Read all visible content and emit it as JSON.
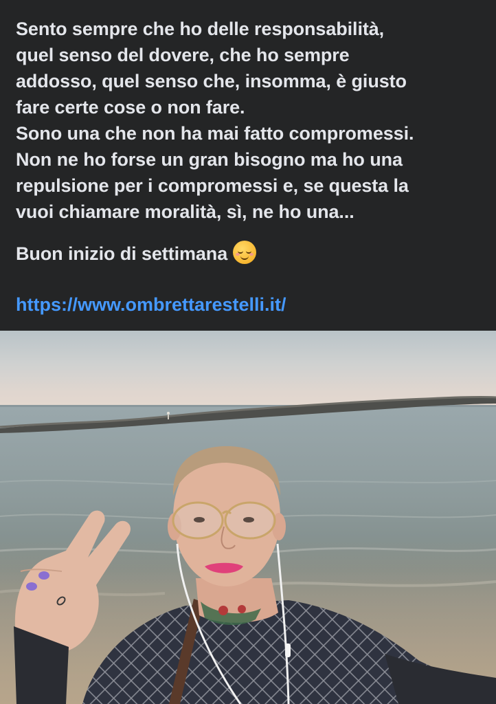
{
  "post": {
    "paragraph_1": "Sento sempre che ho delle responsabilità,\nquel senso del dovere, che ho sempre\naddosso, quel senso che, insomma, è giusto\nfare certe cose o non fare.\nSono una che non ha mai fatto compromessi.\nNon ne ho forse un gran bisogno ma ho una\nrepulsione per i compromessi e, se questa la\nvuoi chiamare moralità, sì, ne ho una...",
    "paragraph_2": "Buon inizio di settimana",
    "emoji": "smiling-face-icon",
    "link": "https://www.ombrettarestelli.it/"
  },
  "colors": {
    "background": "#242526",
    "text": "#e4e6eb",
    "link": "#4599ff"
  }
}
